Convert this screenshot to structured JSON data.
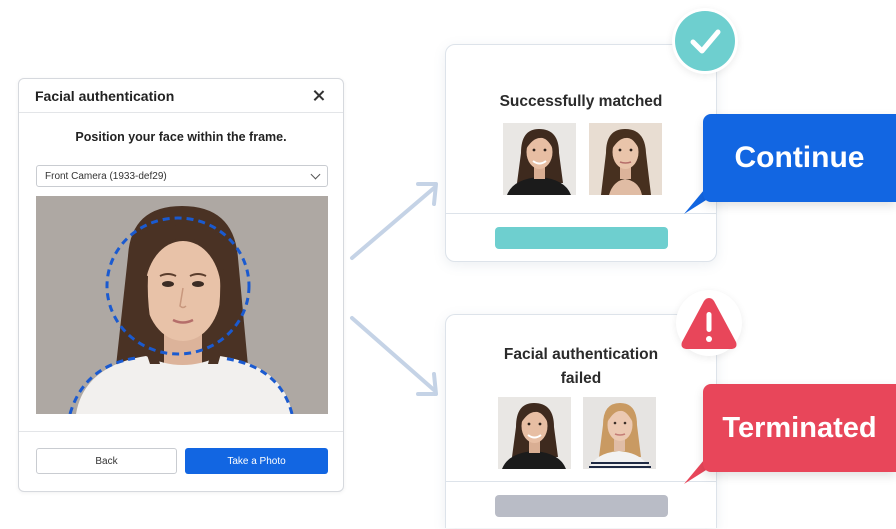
{
  "dialog": {
    "title": "Facial authentication",
    "instruction": "Position your face within the frame.",
    "camera_select_value": "Front Camera (1933-def29)",
    "back_label": "Back",
    "take_photo_label": "Take a Photo"
  },
  "success_card": {
    "title": "Successfully matched",
    "callout": "Continue",
    "accent_color": "#6ecfcf",
    "callout_color": "#1266e2",
    "icon": "checkmark-icon"
  },
  "fail_card": {
    "title_line1": "Facial authentication",
    "title_line2": "failed",
    "callout": "Terminated",
    "accent_color": "#e8465a",
    "bar_color": "#b9bcc6",
    "icon": "warning-icon"
  }
}
